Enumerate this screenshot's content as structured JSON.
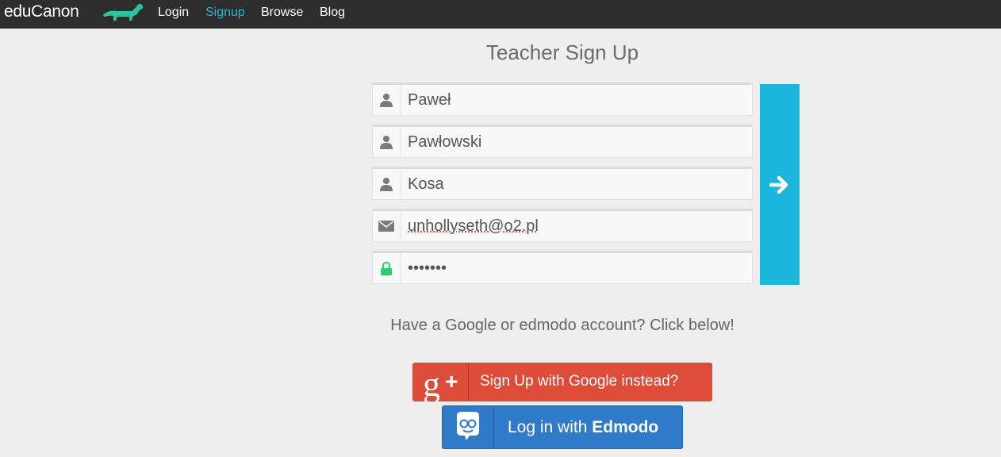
{
  "nav": {
    "brand": "eduCanon",
    "links": [
      "Login",
      "Signup",
      "Browse",
      "Blog"
    ],
    "active": "Signup"
  },
  "form": {
    "title": "Teacher Sign Up",
    "first_name": "Paweł",
    "last_name": "Pawłowski",
    "school": "Kosa",
    "email": "unhollyseth@o2.pl",
    "password": "•••••••",
    "submit_icon": "arrow-right-icon"
  },
  "alt": {
    "prompt": "Have a Google or edmodo account? Click below!",
    "google_label": "Sign Up with Google instead?",
    "edmodo_prefix": "Log in with ",
    "edmodo_brand": "Edmodo"
  },
  "colors": {
    "navbar": "#2d2d2d",
    "accent": "#25b8d9",
    "submit": "#1bb6dc",
    "google": "#dd4b39",
    "edmodo": "#2f7bc9",
    "lock": "#2ecc71",
    "brand_dog": "#2bc3a0"
  }
}
